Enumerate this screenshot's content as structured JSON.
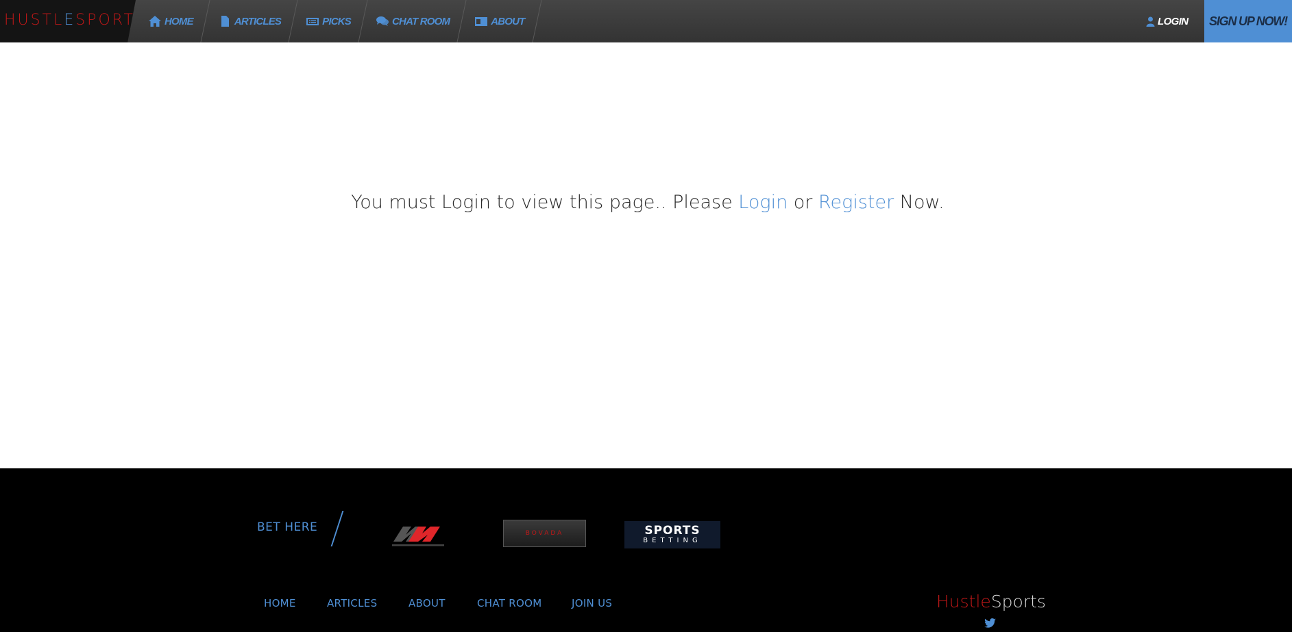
{
  "header": {
    "logo_part1": "HUSTL",
    "logo_part2": "E",
    "logo_part3": "SPORTS",
    "nav": [
      {
        "label": "HOME",
        "icon": "home-icon"
      },
      {
        "label": "ARTICLES",
        "icon": "document-icon"
      },
      {
        "label": "PICKS",
        "icon": "ticket-icon"
      },
      {
        "label": "CHAT ROOM",
        "icon": "chat-icon"
      },
      {
        "label": "ABOUT",
        "icon": "id-card-icon"
      }
    ],
    "login_label": "LOGIN",
    "signup_label": "SIGN UP NOW!"
  },
  "main": {
    "message_prefix": "You must Login to view this page.. Please ",
    "login_link": "Login",
    "or_text": " or ",
    "register_link": "Register",
    "message_suffix": " Now."
  },
  "footer": {
    "bet_here": "BET HERE",
    "partners": [
      {
        "name": "nitrogen-sports-logo"
      },
      {
        "label": "BOVADA"
      },
      {
        "label_line1": "SPORTS",
        "label_line2": "BETTING"
      }
    ],
    "links": [
      "HOME",
      "ARTICLES",
      "ABOUT",
      "CHAT ROOM",
      "JOIN US"
    ],
    "brand_part1": "Hustle",
    "brand_part2": "Sports",
    "social_icon": "twitter-icon"
  },
  "colors": {
    "accent": "#4f8fd4",
    "brand_red": "#c01818",
    "nav_bg": "#3a3a3a",
    "footer_bg": "#000000"
  }
}
